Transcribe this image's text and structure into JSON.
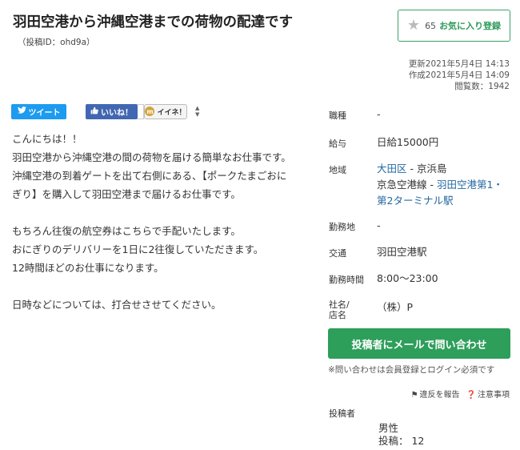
{
  "header": {
    "title": "羽田空港から沖縄空港までの荷物の配達です",
    "post_id": "（投稿ID：ohd9a）"
  },
  "favorite": {
    "count": "65",
    "label": "お気に入り登録",
    "icon": "star-icon"
  },
  "meta": {
    "updated": "更新2021年5月4日 14:13",
    "created": "作成2021年5月4日 14:09",
    "views": "閲覧数：1942"
  },
  "social": {
    "tweet": "ツイート",
    "like": "いいね！",
    "iine": "イイネ！"
  },
  "body": {
    "lines": [
      "こんにちは！！",
      "羽田空港から沖縄空港の間の荷物を届ける簡単なお仕事です。",
      "沖縄空港の到着ゲートを出て右側にある、【ポークたまごおに",
      "ぎり】を購入して羽田空港まで届けるお仕事です。",
      "",
      "もちろん往復の航空券はこちらで手配いたします。",
      "おにぎりのデリバリーを1日に2往復していただきます。",
      "12時間ほどのお仕事になります。",
      "",
      "日時などについては、打合せさせてください。"
    ]
  },
  "details": {
    "occupation_label": "職種",
    "occupation_value": "-",
    "salary_label": "給与",
    "salary_value": "日給15000円",
    "area_label": "地域",
    "area_link": "大田区",
    "area_rest": " - 京浜島",
    "line_prefix": "京急空港線 - ",
    "station_link_1": "羽田空港第1・",
    "station_link_2": "第2ターミナル駅",
    "workplace_label": "勤務地",
    "workplace_value": "-",
    "transport_label": "交通",
    "transport_value": "羽田空港駅",
    "hours_label": "勤務時間",
    "hours_value": "8:00～23:00",
    "company_label_1": "社名/",
    "company_label_2": "店名",
    "company_value": "（株）P"
  },
  "contact": {
    "button": "投稿者にメールで問い合わせ",
    "note": "※問い合わせは会員登録とログイン必須です"
  },
  "links": {
    "report": "違反を報告",
    "notes": "注意事項"
  },
  "poster": {
    "label": "投稿者",
    "gender": "男性",
    "posts": "投稿： 12"
  },
  "colors": {
    "accent_green": "#2e9e5b",
    "link_blue": "#2468a2",
    "twitter": "#1d9bf0",
    "facebook": "#4267b2"
  }
}
